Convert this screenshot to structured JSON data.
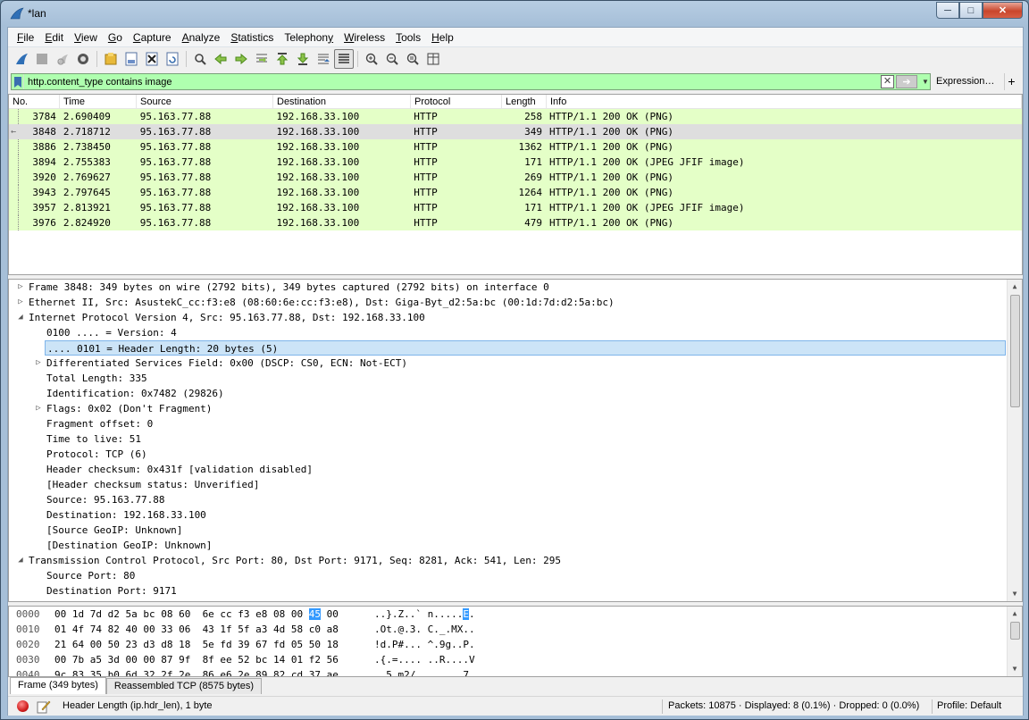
{
  "window": {
    "title": "*lan"
  },
  "menu": [
    "File",
    "Edit",
    "View",
    "Go",
    "Capture",
    "Analyze",
    "Statistics",
    "Telephony",
    "Wireless",
    "Tools",
    "Help"
  ],
  "menu_underline": [
    "F",
    "E",
    "V",
    "G",
    "C",
    "A",
    "S",
    "y",
    "W",
    "T",
    "H"
  ],
  "toolbar_icons": [
    "shark-fin-start-icon",
    "stop-icon",
    "restart-icon",
    "capture-options-icon",
    "open-file-icon",
    "save-file-icon",
    "close-file-icon",
    "reload-icon",
    "find-packet-icon",
    "go-back-icon",
    "go-forward-icon",
    "go-to-packet-icon",
    "first-packet-icon",
    "last-packet-icon",
    "autoscroll-icon",
    "colorize-icon",
    "zoom-in-icon",
    "zoom-out-icon",
    "normal-size-icon",
    "resize-columns-icon"
  ],
  "filter": {
    "value": "http.content_type contains image",
    "expression_label": "Expression…",
    "add_label": "+"
  },
  "packet_list": {
    "columns": [
      "No.",
      "Time",
      "Source",
      "Destination",
      "Protocol",
      "Length",
      "Info"
    ],
    "rows": [
      {
        "no": "3784",
        "time": "2.690409",
        "src": "95.163.77.88",
        "dst": "192.168.33.100",
        "proto": "HTTP",
        "len": "258",
        "info": "HTTP/1.1 200 OK  (PNG)"
      },
      {
        "no": "3848",
        "time": "2.718712",
        "src": "95.163.77.88",
        "dst": "192.168.33.100",
        "proto": "HTTP",
        "len": "349",
        "info": "HTTP/1.1 200 OK  (PNG)"
      },
      {
        "no": "3886",
        "time": "2.738450",
        "src": "95.163.77.88",
        "dst": "192.168.33.100",
        "proto": "HTTP",
        "len": "1362",
        "info": "HTTP/1.1 200 OK  (PNG)"
      },
      {
        "no": "3894",
        "time": "2.755383",
        "src": "95.163.77.88",
        "dst": "192.168.33.100",
        "proto": "HTTP",
        "len": "171",
        "info": "HTTP/1.1 200 OK  (JPEG JFIF image)"
      },
      {
        "no": "3920",
        "time": "2.769627",
        "src": "95.163.77.88",
        "dst": "192.168.33.100",
        "proto": "HTTP",
        "len": "269",
        "info": "HTTP/1.1 200 OK  (PNG)"
      },
      {
        "no": "3943",
        "time": "2.797645",
        "src": "95.163.77.88",
        "dst": "192.168.33.100",
        "proto": "HTTP",
        "len": "1264",
        "info": "HTTP/1.1 200 OK  (PNG)"
      },
      {
        "no": "3957",
        "time": "2.813921",
        "src": "95.163.77.88",
        "dst": "192.168.33.100",
        "proto": "HTTP",
        "len": "171",
        "info": "HTTP/1.1 200 OK  (JPEG JFIF image)"
      },
      {
        "no": "3976",
        "time": "2.824920",
        "src": "95.163.77.88",
        "dst": "192.168.33.100",
        "proto": "HTTP",
        "len": "479",
        "info": "HTTP/1.1 200 OK  (PNG)"
      }
    ]
  },
  "details": [
    {
      "level": 0,
      "state": "collapsed",
      "text": "Frame 3848: 349 bytes on wire (2792 bits), 349 bytes captured (2792 bits) on interface 0"
    },
    {
      "level": 0,
      "state": "collapsed",
      "text": "Ethernet II, Src: AsustekC_cc:f3:e8 (08:60:6e:cc:f3:e8), Dst: Giga-Byt_d2:5a:bc (00:1d:7d:d2:5a:bc)"
    },
    {
      "level": 0,
      "state": "expanded",
      "text": "Internet Protocol Version 4, Src: 95.163.77.88, Dst: 192.168.33.100"
    },
    {
      "level": 1,
      "state": "leaf",
      "text": "0100 .... = Version: 4"
    },
    {
      "level": 1,
      "state": "leaf",
      "text": ".... 0101 = Header Length: 20 bytes (5)",
      "selected": true
    },
    {
      "level": 1,
      "state": "collapsed",
      "text": "Differentiated Services Field: 0x00 (DSCP: CS0, ECN: Not-ECT)"
    },
    {
      "level": 1,
      "state": "leaf",
      "text": "Total Length: 335"
    },
    {
      "level": 1,
      "state": "leaf",
      "text": "Identification: 0x7482 (29826)"
    },
    {
      "level": 1,
      "state": "collapsed",
      "text": "Flags: 0x02 (Don't Fragment)"
    },
    {
      "level": 1,
      "state": "leaf",
      "text": "Fragment offset: 0"
    },
    {
      "level": 1,
      "state": "leaf",
      "text": "Time to live: 51"
    },
    {
      "level": 1,
      "state": "leaf",
      "text": "Protocol: TCP (6)"
    },
    {
      "level": 1,
      "state": "leaf",
      "text": "Header checksum: 0x431f [validation disabled]"
    },
    {
      "level": 1,
      "state": "leaf",
      "text": "[Header checksum status: Unverified]"
    },
    {
      "level": 1,
      "state": "leaf",
      "text": "Source: 95.163.77.88"
    },
    {
      "level": 1,
      "state": "leaf",
      "text": "Destination: 192.168.33.100"
    },
    {
      "level": 1,
      "state": "leaf",
      "text": "[Source GeoIP: Unknown]"
    },
    {
      "level": 1,
      "state": "leaf",
      "text": "[Destination GeoIP: Unknown]"
    },
    {
      "level": 0,
      "state": "expanded",
      "text": "Transmission Control Protocol, Src Port: 80, Dst Port: 9171, Seq: 8281, Ack: 541, Len: 295"
    },
    {
      "level": 1,
      "state": "leaf",
      "text": "Source Port: 80"
    },
    {
      "level": 1,
      "state": "leaf",
      "text": "Destination Port: 9171"
    }
  ],
  "bytes": [
    {
      "offset": "0000",
      "hex_a": "00 1d 7d d2 5a bc 08 60  6e cc f3 e8 08 00 ",
      "hex_hl": "45",
      "hex_b": " 00",
      "asc_a": "..}.Z..` n.....",
      "asc_hl": "E",
      "asc_b": "."
    },
    {
      "offset": "0010",
      "hex_a": "01 4f 74 82 40 00 33 06  43 1f 5f a3 4d 58 c0 a8",
      "hex_hl": "",
      "hex_b": "",
      "asc_a": ".Ot.@.3. C._.MX..",
      "asc_hl": "",
      "asc_b": ""
    },
    {
      "offset": "0020",
      "hex_a": "21 64 00 50 23 d3 d8 18  5e fd 39 67 fd 05 50 18",
      "hex_hl": "",
      "hex_b": "",
      "asc_a": "!d.P#... ^.9g..P.",
      "asc_hl": "",
      "asc_b": ""
    },
    {
      "offset": "0030",
      "hex_a": "00 7b a5 3d 00 00 87 9f  8f ee 52 bc 14 01 f2 56",
      "hex_hl": "",
      "hex_b": "",
      "asc_a": ".{.=.... ..R....V",
      "asc_hl": "",
      "asc_b": ""
    },
    {
      "offset": "0040",
      "hex_a": "9c 83 35 b0 6d 32 2f 2e  86 e6 2e 89 82 cd 37 ae",
      "hex_hl": "",
      "hex_b": "",
      "asc_a": "..5.m2/. ......7.",
      "asc_hl": "",
      "asc_b": ""
    }
  ],
  "byte_tabs": [
    "Frame (349 bytes)",
    "Reassembled TCP (8575 bytes)"
  ],
  "status": {
    "field_info": "Header Length (ip.hdr_len), 1 byte",
    "packets": "Packets: 10875 · Displayed: 8 (0.1%) · Dropped: 0 (0.0%)",
    "profile": "Profile: Default"
  },
  "colors": {
    "packet_row_bg": "#e4ffc7",
    "filter_bg": "#afffaf",
    "tree_selected": "#cce4f7",
    "byte_highlight": "#3399ff"
  }
}
